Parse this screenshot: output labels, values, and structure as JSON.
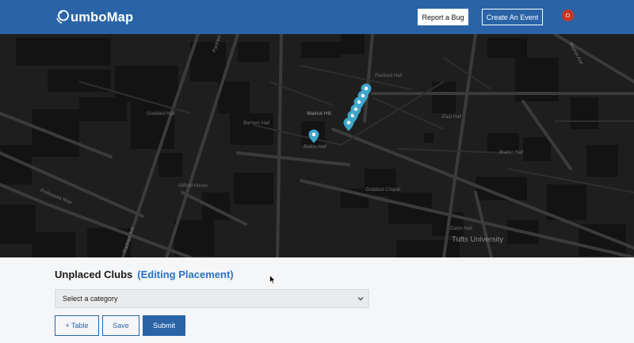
{
  "navbar": {
    "logo_text": "umboMap",
    "report_label": "Report a Bug",
    "create_label": "Create An Event",
    "avatar_initial": "D",
    "brand_color": "#2a64a7"
  },
  "map": {
    "places": {
      "packard_hall": "Packard Hall",
      "goddard_hall": "Goddard Hall",
      "walnut_hill": "Walnut Hill",
      "east_hall": "East Hall",
      "barnum_hall": "Barnum Hall",
      "ballou_hall": "Ballou Hall",
      "braker_hall": "Braker Hall",
      "gifford_house": "Gifford House",
      "goddard_chapel": "Goddard Chapel",
      "eaton_hall": "Eaton Hall",
      "tufts_university": "Tufts University"
    },
    "roads": {
      "packard_ave_top": "Packard Ave",
      "packard_ave_bottom": "Packard Ave",
      "professors_row": "Professors Row",
      "boston_ave": "Boston Ave"
    },
    "pin_color": "#3fa6c9",
    "pin_icon": "map-marker-icon"
  },
  "placement": {
    "title": "Unplaced Clubs",
    "editing_label": "(Editing Placement)",
    "category_select": "Select a category",
    "add_table_label": "+ Table",
    "save_label": "Save",
    "submit_label": "Submit"
  }
}
